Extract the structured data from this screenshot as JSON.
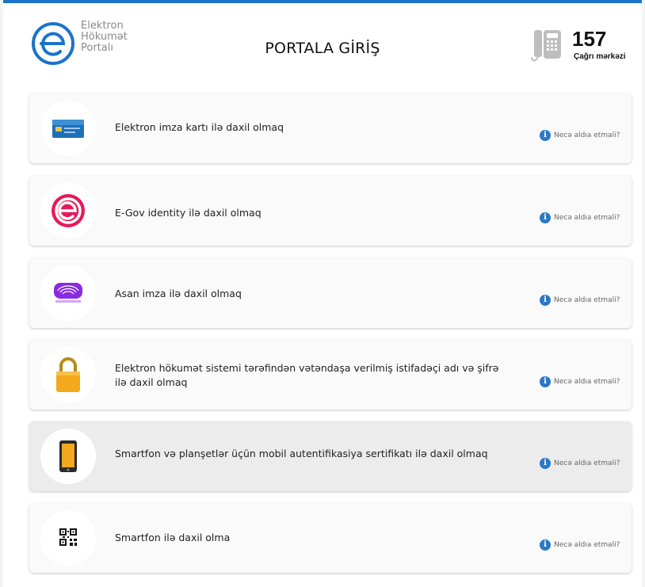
{
  "header": {
    "logo_lines": [
      "Elektron",
      "Hökumət",
      "Portalı"
    ],
    "title": "PORTALA GİRİŞ",
    "callcenter_number": "157",
    "callcenter_label": "Çağrı mərkəzi"
  },
  "colors": {
    "accent": "#1a73c9",
    "egov_pink": "#e6185a",
    "info_blue": "#2b78c5"
  },
  "login_options": [
    {
      "label": "Elektron imza kartı ilə daxil olmaq",
      "icon": "id-card-icon",
      "help": "Necə aldıa etmali?"
    },
    {
      "label": "E-Gov identity ilə daxil olmaq",
      "icon": "egov-logo-icon",
      "help": "Necə aldıa etmali?"
    },
    {
      "label": "Asan imza ilə daxil olmaq",
      "icon": "asan-imza-icon",
      "help": "Necə aldıa etmali?"
    },
    {
      "label": "Elektron hökumət sistemi tərəfindən vətəndaşa verilmiş istifadəçi adı və şifrə ilə daxil olmaq",
      "icon": "padlock-icon",
      "help": "Necə aldıa etmali?"
    },
    {
      "label": "Smartfon və planşetlər üçün mobil autentifikasiya sertifikatı ilə daxil olmaq",
      "icon": "smartphone-icon",
      "help": "Necə aldıa etmali?"
    },
    {
      "label": "Smartfon ilə daxil olma",
      "icon": "qr-code-icon",
      "help": "Necə aldıa etmali?"
    }
  ]
}
